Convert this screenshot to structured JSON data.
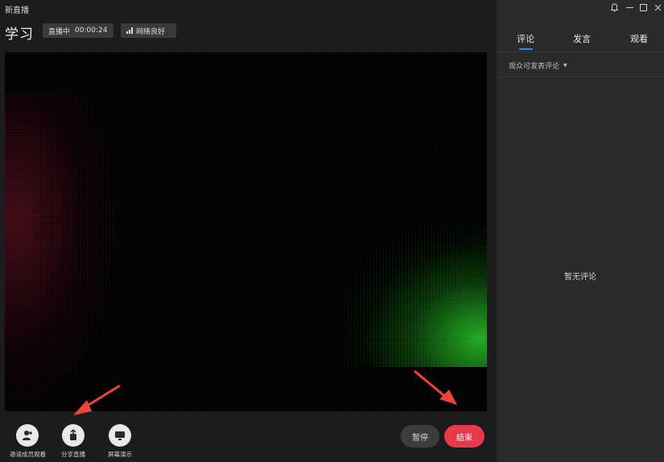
{
  "window": {
    "title": "新直播"
  },
  "room": {
    "title": "学习",
    "status": "直播中",
    "elapsed": "00:00:24",
    "network": "网络良好"
  },
  "toolbar": {
    "tools": [
      {
        "label": "邀请成员观看",
        "icon": "invite-user-icon"
      },
      {
        "label": "分享直播",
        "icon": "share-icon"
      },
      {
        "label": "屏幕演示",
        "icon": "screen-share-icon"
      }
    ],
    "pause_label": "暂停",
    "end_label": "结束"
  },
  "sidebar": {
    "tabs": [
      {
        "label": "评论",
        "active": true
      },
      {
        "label": "发言",
        "active": false
      },
      {
        "label": "观看",
        "active": false
      }
    ],
    "permission_label": "观众可发表评论",
    "empty_text": "暂无评论"
  },
  "colors": {
    "accent": "#3b82f6",
    "end_button": "#e8394a",
    "annotation_arrow": "#f04438"
  }
}
